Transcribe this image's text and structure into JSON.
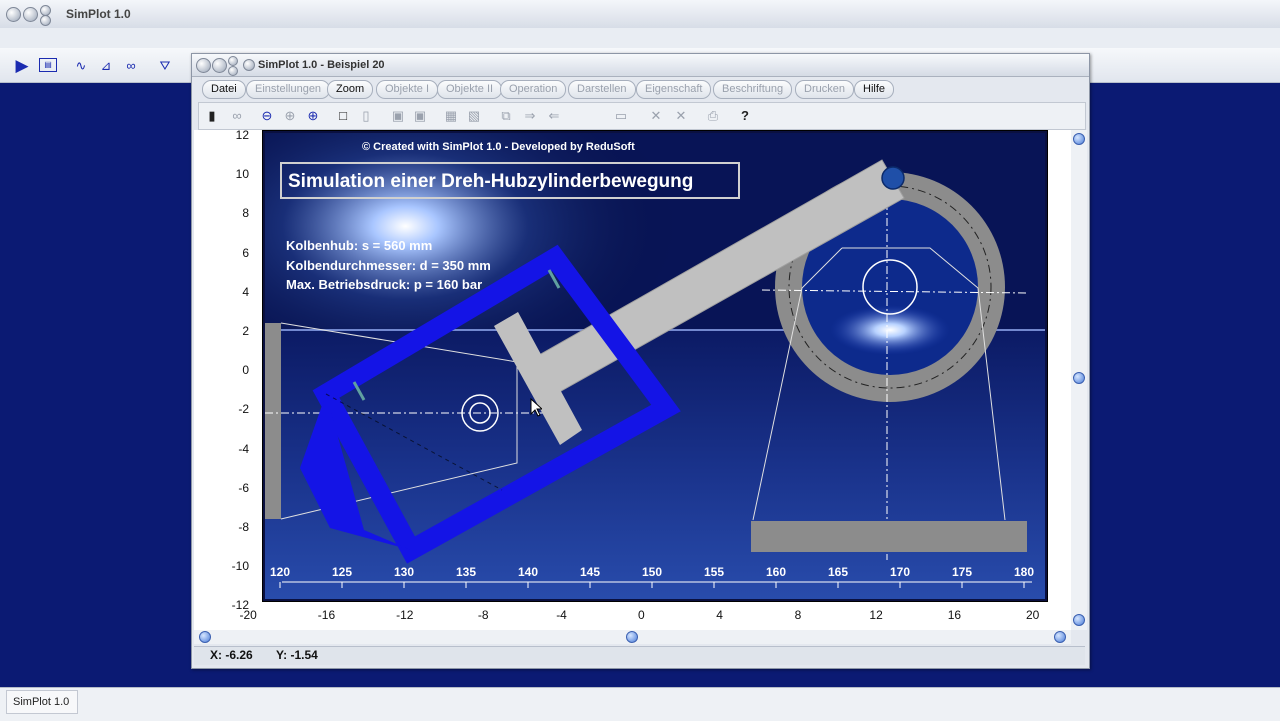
{
  "app": {
    "title": "SimPlot 1.0",
    "taskbar_label": "SimPlot 1.0"
  },
  "window": {
    "title": "SimPlot 1.0 - Beispiel 20",
    "menu": [
      {
        "label": "Datei",
        "enabled": true
      },
      {
        "label": "Einstellungen",
        "enabled": false
      },
      {
        "label": "Zoom",
        "enabled": true
      },
      {
        "label": "Objekte I",
        "enabled": false
      },
      {
        "label": "Objekte II",
        "enabled": false
      },
      {
        "label": "Operation",
        "enabled": false
      },
      {
        "label": "Darstellen",
        "enabled": false
      },
      {
        "label": "Eigenschaft",
        "enabled": false
      },
      {
        "label": "Beschriftung",
        "enabled": false
      },
      {
        "label": "Drucken",
        "enabled": false
      },
      {
        "label": "Hilfe",
        "enabled": true
      }
    ]
  },
  "plot": {
    "credit": "© Created with SimPlot 1.0 - Developed by ReduSoft",
    "heading": "Simulation einer Dreh-Hubzylinderbewegung",
    "info_lines": [
      "Kolbenhub: s = 560 mm",
      "Kolbendurchmesser: d = 350 mm",
      "Max. Betriebsdruck: p = 160 bar"
    ],
    "y_ticks": [
      "12",
      "10",
      "8",
      "6",
      "4",
      "2",
      "0",
      "-2",
      "-4",
      "-6",
      "-8",
      "-10",
      "-12"
    ],
    "x_ticks": [
      "-20",
      "-16",
      "-12",
      "-8",
      "-4",
      "0",
      "4",
      "8",
      "12",
      "16",
      "20"
    ],
    "inner_ticks": [
      "120",
      "125",
      "130",
      "135",
      "140",
      "145",
      "150",
      "155",
      "160",
      "165",
      "170",
      "175",
      "180"
    ]
  },
  "coords": {
    "x_label": "X: -6.26",
    "y_label": "Y: -1.54"
  },
  "colors": {
    "desktop": "#0b1a73",
    "cylinder": "#1414e6",
    "rod": "#c0c0c0",
    "ring": "#8c8c8c"
  }
}
